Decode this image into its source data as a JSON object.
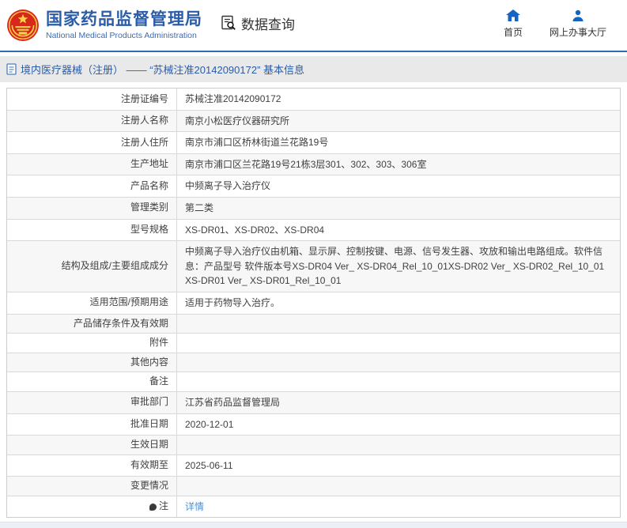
{
  "header": {
    "org_name_cn": "国家药品监督管理局",
    "org_name_en": "National Medical Products Administration",
    "section_title": "数据查询",
    "nav": [
      {
        "label": "首页",
        "icon": "home-icon"
      },
      {
        "label": "网上办事大厅",
        "icon": "user-icon"
      }
    ]
  },
  "breadcrumb": {
    "text": "境内医疗器械（注册） —— “苏械注准20142090172” 基本信息"
  },
  "table": {
    "rows": [
      {
        "label": "注册证编号",
        "value": "苏械注准20142090172"
      },
      {
        "label": "注册人名称",
        "value": "南京小松医疗仪器研究所"
      },
      {
        "label": "注册人住所",
        "value": "南京市浦口区桥林街道兰花路19号"
      },
      {
        "label": "生产地址",
        "value": "南京市浦口区兰花路19号21栋3层301、302、303、306室"
      },
      {
        "label": "产品名称",
        "value": "中频离子导入治疗仪"
      },
      {
        "label": "管理类别",
        "value": "第二类"
      },
      {
        "label": "型号规格",
        "value": "XS-DR01、XS-DR02、XS-DR04"
      },
      {
        "label": "结构及组成/主要组成成分",
        "value": "中频离子导入治疗仪由机箱、显示屏、控制按键、电源、信号发生器、攻放和输出电路组成。软件信息：产品型号 软件版本号XS-DR04 Ver_ XS-DR04_Rel_10_01XS-DR02 Ver_ XS-DR02_Rel_10_01XS-DR01 Ver_ XS-DR01_Rel_10_01"
      },
      {
        "label": "适用范围/预期用途",
        "value": "适用于药物导入治疗。"
      },
      {
        "label": "产品储存条件及有效期",
        "value": ""
      },
      {
        "label": "附件",
        "value": ""
      },
      {
        "label": "其他内容",
        "value": ""
      },
      {
        "label": "备注",
        "value": ""
      },
      {
        "label": "审批部门",
        "value": "江苏省药品监督管理局"
      },
      {
        "label": "批准日期",
        "value": "2020-12-01"
      },
      {
        "label": "生效日期",
        "value": ""
      },
      {
        "label": "有效期至",
        "value": "2025-06-11"
      },
      {
        "label": "变更情况",
        "value": ""
      },
      {
        "label": "注",
        "value": "详情",
        "value_is_link": true,
        "label_icon": "note-bullet-icon"
      }
    ]
  },
  "colors": {
    "accent_blue": "#2a5ca8",
    "header_rule_blue": "#2e6cb3",
    "nav_icon_blue": "#1565c0",
    "link_blue": "#4a90d9",
    "crumb_bar_bg": "#e9e9e9",
    "row_alt_bg": "#f7f7f7",
    "emblem_red": "#d8281c",
    "emblem_gold": "#f8d04a"
  }
}
